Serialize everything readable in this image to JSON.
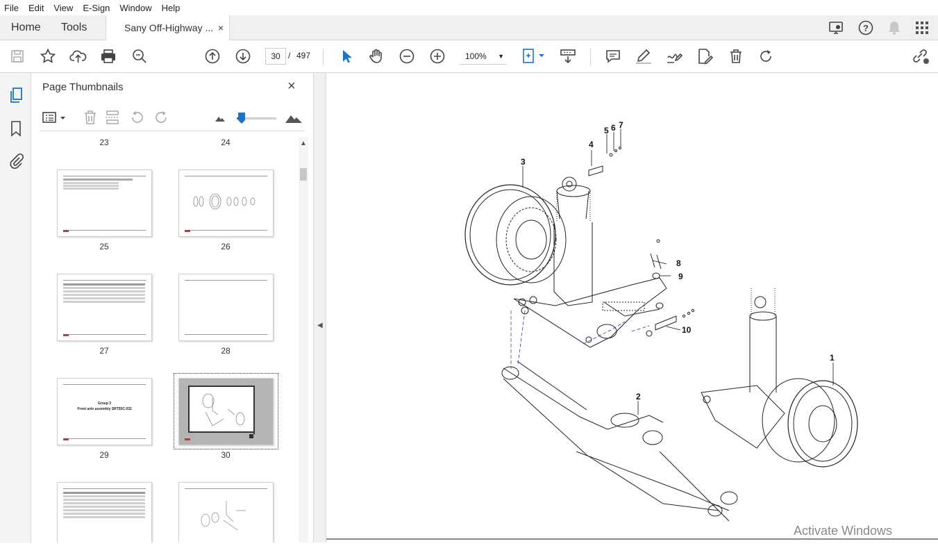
{
  "menu": [
    "File",
    "Edit",
    "View",
    "E-Sign",
    "Window",
    "Help"
  ],
  "tabs": {
    "home": "Home",
    "tools": "Tools",
    "document": "Sany Off-Highway ...",
    "close": "×"
  },
  "toolbar": {
    "current_page": "30",
    "page_sep": "/",
    "total_pages": "497",
    "zoom": "100%"
  },
  "panel": {
    "title": "Page Thumbnails",
    "close": "×",
    "thumb_text": {
      "group": "Group 3",
      "group_sub": "Front axle assembly SRT55C.032"
    },
    "pages": [
      "23",
      "24",
      "25",
      "26",
      "27",
      "28",
      "29",
      "30"
    ]
  },
  "drawing": {
    "callouts": [
      "1",
      "2",
      "3",
      "4",
      "5",
      "6",
      "7",
      "8",
      "9",
      "10"
    ]
  },
  "watermark": "Activate Windows",
  "icons": {
    "save": "save-icon",
    "bookmark_star": "star-icon",
    "upload": "upload-icon",
    "print": "print-icon",
    "find": "search-zoom-icon",
    "prev": "arrow-up-icon",
    "next": "arrow-down-icon",
    "select": "cursor-icon",
    "hand": "hand-icon",
    "zoom_out": "zoom-out-icon",
    "zoom_in": "zoom-in-icon",
    "fit": "fit-page-icon",
    "scroll": "scroll-mode-icon",
    "comment": "comment-icon",
    "highlight": "highlight-icon",
    "sign": "sign-icon",
    "edit": "edit-icon",
    "delete": "trash-icon",
    "rotate": "rotate-icon",
    "share": "share-link-icon"
  }
}
